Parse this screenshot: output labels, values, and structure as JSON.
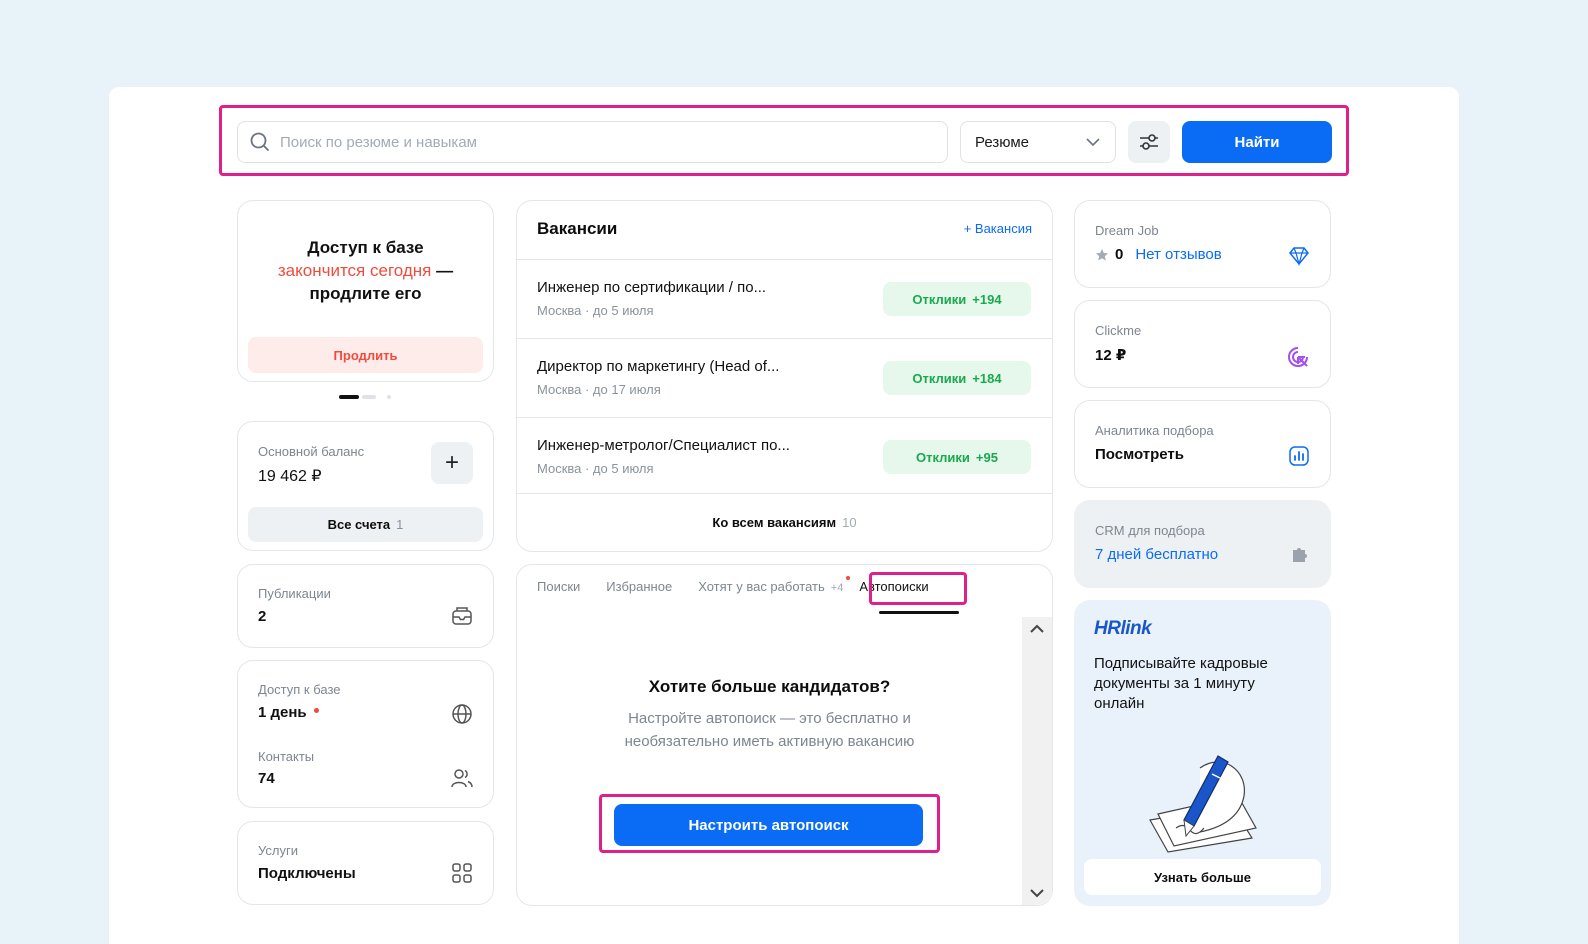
{
  "search": {
    "placeholder": "Поиск по резюме и навыкам",
    "type_selected": "Резюме",
    "find_label": "Найти"
  },
  "promo": {
    "line1": "Доступ к базе",
    "line2_red": "закончится сегодня",
    "line2_rest": " —",
    "line3": "продлите его",
    "renew_label": "Продлить"
  },
  "balance": {
    "label": "Основной баланс",
    "value": "19 462 ₽",
    "accounts_label": "Все счета",
    "accounts_count": "1"
  },
  "publications": {
    "label": "Публикации",
    "value": "2"
  },
  "db_access": {
    "label": "Доступ к базе",
    "value": "1 день",
    "contacts_label": "Контакты",
    "contacts_value": "74"
  },
  "services": {
    "label": "Услуги",
    "value": "Подключены"
  },
  "vacancies": {
    "title": "Вакансии",
    "add_label": "+ Вакансия",
    "items": [
      {
        "title": "Инженер по сертификации / по...",
        "meta": "Москва · до 5 июля",
        "badge_label": "Отклики",
        "badge_count": "+194"
      },
      {
        "title": "Директор по маркетингу (Head of...",
        "meta": "Москва · до 17 июля",
        "badge_label": "Отклики",
        "badge_count": "+184"
      },
      {
        "title": "Инженер-метролог/Специалист по...",
        "meta": "Москва · до 5 июля",
        "badge_label": "Отклики",
        "badge_count": "+95"
      }
    ],
    "all_label": "Ко всем вакансиям",
    "all_count": "10"
  },
  "tabs": {
    "items": [
      "Поиски",
      "Избранное",
      "Хотят у вас работать",
      "Автопоиски"
    ],
    "want_count": "+4",
    "active": "Автопоиски"
  },
  "autosearch": {
    "title": "Хотите больше кандидатов?",
    "text": "Настройте автопоиск — это бесплатно и необязательно иметь активную вакансию",
    "button": "Настроить автопоиск"
  },
  "dreamjob": {
    "label": "Dream Job",
    "rating": "0",
    "reviews_link": "Нет отзывов"
  },
  "clickme": {
    "label": "Clickme",
    "value": "12 ₽"
  },
  "analytics": {
    "label": "Аналитика подбора",
    "value": "Посмотреть"
  },
  "crm": {
    "label": "CRM для подбора",
    "value": "7 дней бесплатно"
  },
  "hrlink": {
    "logo": "HRlink",
    "text": "Подписывайте кадровые документы за 1 минуту онлайн",
    "button": "Узнать больше"
  },
  "colors": {
    "accent": "#0a6cf5",
    "highlight": "#e0208a",
    "danger": "#f04b3c",
    "success": "#1aa94d"
  }
}
